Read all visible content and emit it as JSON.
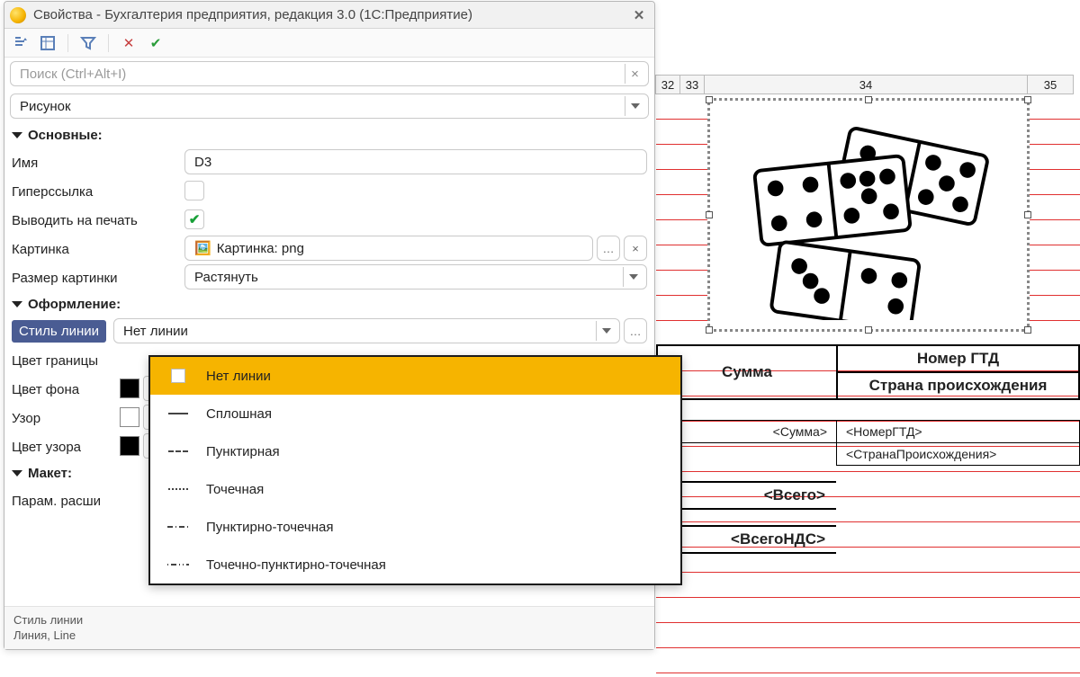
{
  "window": {
    "title": "Свойства - Бухгалтерия предприятия, редакция 3.0  (1С:Предприятие)",
    "search_placeholder": "Поиск (Ctrl+Alt+I)",
    "object_type": "Рисунок"
  },
  "sections": {
    "main": {
      "label": "Основные:"
    },
    "style": {
      "label": "Оформление:"
    },
    "layout": {
      "label": "Макет:"
    }
  },
  "props": {
    "name": {
      "label": "Имя",
      "value": "D3"
    },
    "hyperlink": {
      "label": "Гиперссылка",
      "checked": false
    },
    "print": {
      "label": "Выводить на печать",
      "checked": true
    },
    "picture": {
      "label": "Картинка",
      "value": "Картинка: png"
    },
    "picsize": {
      "label": "Размер картинки",
      "value": "Растянуть"
    },
    "linestyle": {
      "label": "Стиль линии",
      "value": "Нет линии"
    },
    "bordercolor": {
      "label": "Цвет границы"
    },
    "bgcolor": {
      "label": "Цвет фона"
    },
    "pattern": {
      "label": "Узор"
    },
    "patterncolor": {
      "label": "Цвет узора"
    },
    "paramexp": {
      "label": "Парам. расши"
    }
  },
  "linestyle_options": [
    {
      "label": "Нет линии",
      "glyph": "none",
      "selected": true
    },
    {
      "label": "Сплошная",
      "glyph": "solid",
      "selected": false
    },
    {
      "label": "Пунктирная",
      "glyph": "dash",
      "selected": false
    },
    {
      "label": "Точечная",
      "glyph": "dot",
      "selected": false
    },
    {
      "label": "Пунктирно-точечная",
      "glyph": "dashdot",
      "selected": false
    },
    {
      "label": "Точечно-пунктирно-точечная",
      "glyph": "dotdashdot",
      "selected": false
    }
  ],
  "status": {
    "line1": "Стиль линии",
    "line2": "Линия, Line"
  },
  "sheet": {
    "cols": [
      "32",
      "33",
      "34",
      "35"
    ],
    "header1": {
      "c1": "Сумма",
      "c2": "Номер ГТД",
      "c3": "Страна происхождения"
    },
    "row_fields": {
      "c1": "<Сумма>",
      "c2": "<НомерГТД>",
      "c3": "<СтранаПроисхождения>"
    },
    "totals": {
      "vsego": "<Всего>",
      "vsegonds": "<ВсегоНДС>"
    }
  }
}
